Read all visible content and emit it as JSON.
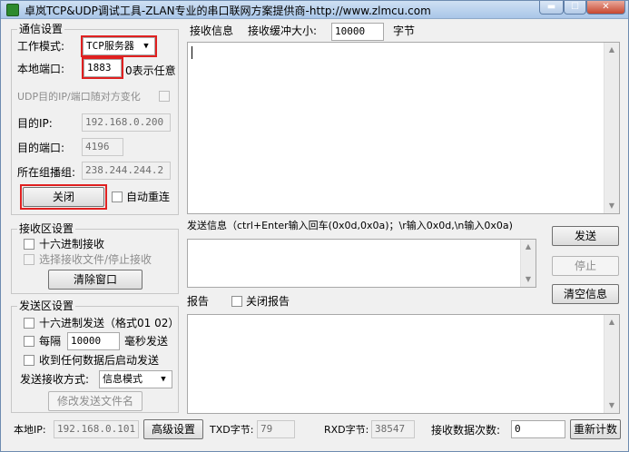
{
  "window": {
    "title": "卓岚TCP&UDP调试工具-ZLAN专业的串口联网方案提供商-http://www.zlmcu.com",
    "min_glyph": "▬",
    "max_glyph": "☐",
    "close_glyph": "✕"
  },
  "comm": {
    "group_title": "通信设置",
    "mode_label": "工作模式:",
    "mode_value": "TCP服务器",
    "local_port_label": "本地端口:",
    "local_port_value": "1883",
    "port_hint": "0表示任意",
    "udp_random_label": "UDP目的IP/端口随对方变化",
    "dest_ip_label": "目的IP:",
    "dest_ip_value": "192.168.0.200",
    "dest_port_label": "目的端口:",
    "dest_port_value": "4196",
    "multicast_label": "所在组播组:",
    "multicast_value": "238.244.244.2",
    "close_button": "关闭",
    "auto_reconnect_label": "自动重连"
  },
  "recv_settings": {
    "group_title": "接收区设置",
    "hex_recv_label": "十六进制接收",
    "select_file_label": "选择接收文件/停止接收",
    "clear_button": "清除窗口"
  },
  "send_settings": {
    "group_title": "发送区设置",
    "hex_send_label": "十六进制发送（格式01 02）",
    "every_label": "每隔",
    "interval_value": "10000",
    "ms_send_label": "毫秒发送",
    "start_on_recv_label": "收到任何数据后启动发送",
    "mode_label": "发送接收方式:",
    "mode_value": "信息模式",
    "modify_file_button": "修改发送文件名"
  },
  "receive": {
    "label": "接收信息",
    "buffer_label": "接收缓冲大小:",
    "buffer_value": "10000",
    "unit": "字节"
  },
  "send": {
    "label": "发送信息（ctrl+Enter输入回车(0x0d,0x0a)；\\r输入0x0d,\\n输入0x0a)",
    "send_button": "发送",
    "stop_button": "停止",
    "clear_info_button": "清空信息"
  },
  "report": {
    "label": "报告",
    "close_report_label": "关闭报告"
  },
  "statusbar": {
    "local_ip_label": "本地IP:",
    "local_ip_value": "192.168.0.101",
    "advanced_button": "高级设置",
    "txd_label": "TXD字节:",
    "txd_value": "79",
    "rxd_label": "RXD字节:",
    "rxd_value": "38547",
    "recv_count_label": "接收数据次数:",
    "recv_count_value": "0",
    "recount_button": "重新计数"
  },
  "colors": {
    "highlight_red": "#e02020",
    "window_bg": "#f0f0f0"
  },
  "icons": {
    "app": "app-icon",
    "dropdown": "chevron-down-icon",
    "scroll_up": "scroll-up-icon",
    "scroll_down": "scroll-down-icon"
  }
}
